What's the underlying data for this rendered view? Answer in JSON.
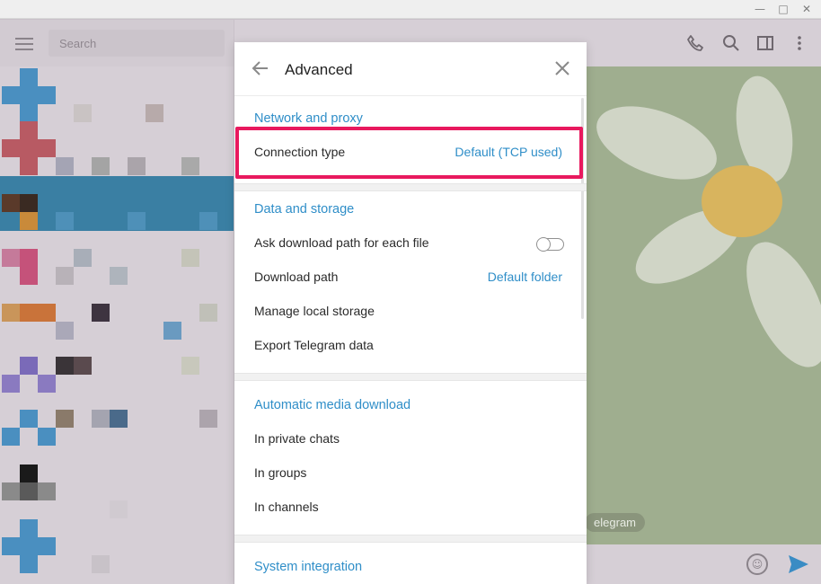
{
  "window": {
    "minimize_glyph": "—",
    "maximize_glyph": "□",
    "close_glyph": "✕"
  },
  "sidebar": {
    "search_placeholder": "Search"
  },
  "chat": {
    "watermark": "elegram"
  },
  "modal": {
    "title": "Advanced",
    "sections": {
      "network": {
        "title": "Network and proxy",
        "connection_type_label": "Connection type",
        "connection_type_value": "Default (TCP used)"
      },
      "data": {
        "title": "Data and storage",
        "ask_path_label": "Ask download path for each file",
        "ask_path_enabled": false,
        "download_path_label": "Download path",
        "download_path_value": "Default folder",
        "manage_storage_label": "Manage local storage",
        "export_label": "Export Telegram data"
      },
      "media": {
        "title": "Automatic media download",
        "private_label": "In private chats",
        "groups_label": "In groups",
        "channels_label": "In channels"
      },
      "system": {
        "title": "System integration"
      }
    }
  },
  "colors": {
    "accent": "#2f8ec8",
    "highlight": "#e8195e",
    "active_chat": "#3a7fa3"
  },
  "icons": [
    "menu-icon",
    "phone-icon",
    "search-icon",
    "sidebar-toggle-icon",
    "more-vert-icon",
    "back-arrow-icon",
    "close-icon",
    "emoji-icon",
    "send-icon"
  ]
}
